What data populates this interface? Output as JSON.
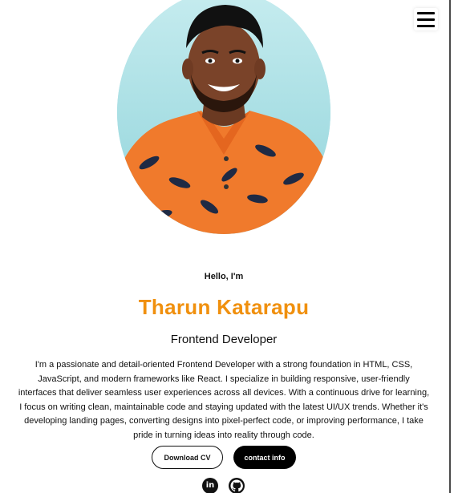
{
  "header": {
    "menu_icon": "hamburger-menu-icon"
  },
  "hero": {
    "greeting": "Hello, I'm",
    "name": "Tharun Katarapu",
    "role": "Frontend Developer",
    "bio": "I'm a passionate and detail-oriented Frontend Developer with a strong foundation in HTML, CSS, JavaScript, and modern frameworks like React. I specialize in building responsive, user-friendly interfaces that deliver seamless user experiences across all devices. With a continuous drive for learning, I focus on writing clean, maintainable code and staying updated with the latest UI/UX trends. Whether it's developing landing pages, converting designs into pixel-perfect code, or improving performance, I take pride in turning ideas into reality through code."
  },
  "actions": {
    "download_cv_label": "Download CV",
    "contact_label": "contact info"
  },
  "social": {
    "linkedin_icon": "linkedin-icon",
    "linkedin_glyph": "in",
    "github_icon": "github-icon"
  },
  "colors": {
    "accent": "#f0900e",
    "text": "#111111",
    "background": "#ffffff",
    "button_dark": "#000000"
  }
}
